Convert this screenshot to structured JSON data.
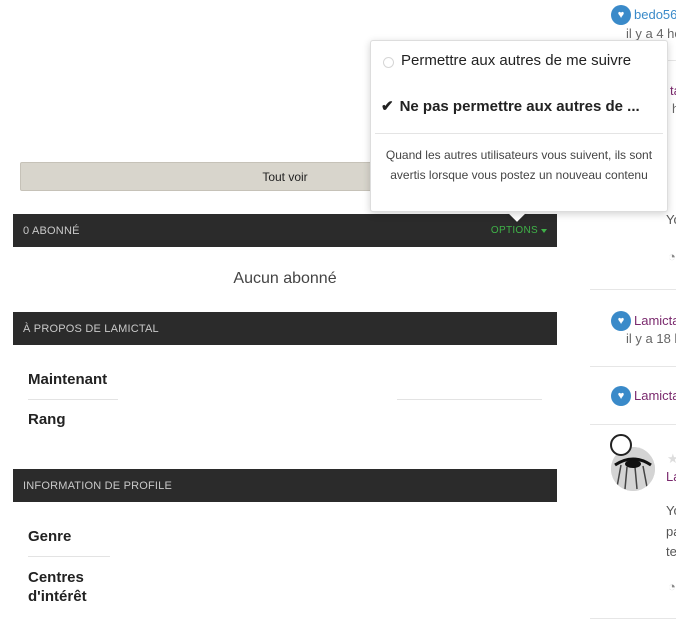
{
  "see_all_label": "Tout voir",
  "followers": {
    "header": "0 ABONNÉ",
    "options_label": "OPTIONS",
    "empty_text": "Aucun abonné"
  },
  "about": {
    "header": "À PROPOS DE LAMICTAL",
    "rows": [
      "Maintenant",
      "Rang"
    ]
  },
  "profile_info": {
    "header": "INFORMATION DE PROFILE",
    "rows": [
      "Genre",
      "Centres d'intérêt"
    ]
  },
  "options_menu": {
    "item_allow": "Permettre aux autres de me suivre",
    "item_deny": "Ne pas permettre aux autres de ...",
    "description": "Quand les autres utilisateurs vous suivent, ils sont avertis lorsque vous postez un nouveau contenu"
  },
  "activity": {
    "item1_user": "bedo56",
    "item1_time": "il y a 4 he",
    "item2_user": "ta",
    "item2_sub": "h",
    "item3_text": "Yo",
    "item4_user": "Lamicta",
    "item4_time": "il y a 18 h",
    "item5_user": "Lamicta",
    "item6_user": "La",
    "item6_text1": "Yo",
    "item6_text2": "pa",
    "item6_text3": "te",
    "accent_color": "#3a8ac9",
    "user_color": "#7b2a6e"
  }
}
